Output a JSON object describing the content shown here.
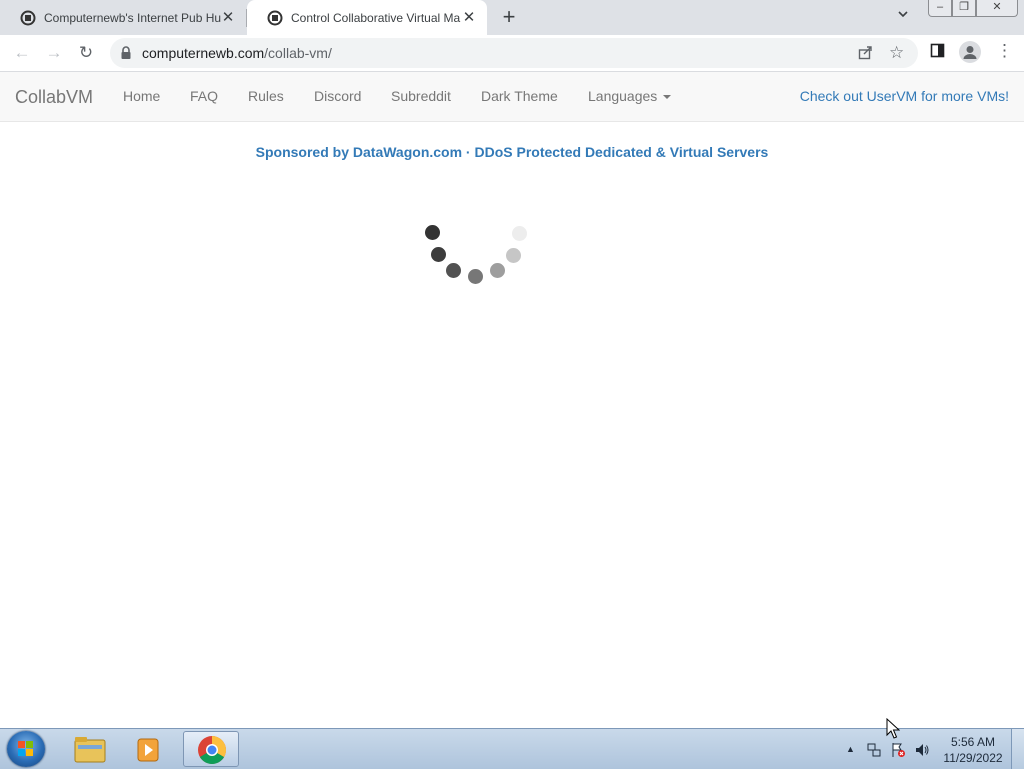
{
  "browser": {
    "tabs": [
      {
        "title": "Computernewb's Internet Pub Hu",
        "active": false,
        "close": "✕"
      },
      {
        "title": "Control Collaborative Virtual Ma",
        "active": true,
        "close": "✕"
      }
    ],
    "new_tab": "+",
    "tab_search": "⌄",
    "window_controls": {
      "minimize": "–",
      "restore": "❐",
      "close": "✕"
    },
    "nav": {
      "back": "←",
      "forward": "→",
      "reload": "↻"
    },
    "url": {
      "domain": "computernewb.com",
      "path": "/collab-vm/"
    },
    "icons": {
      "share": "share-icon",
      "bookmark": "☆",
      "sidepanel": "sidepanel-icon",
      "menu": "⋮"
    }
  },
  "site": {
    "brand": "CollabVM",
    "nav": [
      "Home",
      "FAQ",
      "Rules",
      "Discord",
      "Subreddit",
      "Dark Theme"
    ],
    "languages": "Languages",
    "right_link": "Check out UserVM for more VMs!",
    "sponsor": "Sponsored by DataWagon.com · DDoS Protected Dedicated & Virtual Servers"
  },
  "taskbar": {
    "clock_time": "5:56 AM",
    "clock_date": "11/29/2022",
    "tray_expand": "▲",
    "pinned": [
      "explorer-icon",
      "media-player-icon",
      "chrome-icon"
    ]
  },
  "colors": {
    "link": "#337ab7",
    "navbar_bg": "#f8f8f8",
    "tabstrip_bg": "#dee1e6"
  }
}
